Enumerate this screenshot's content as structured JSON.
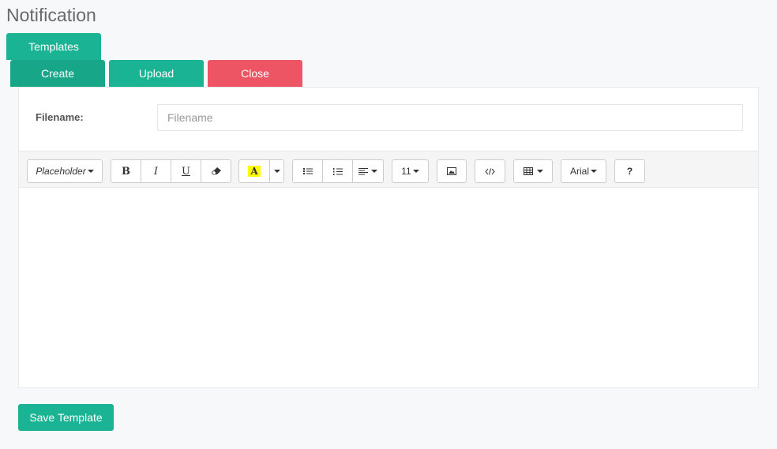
{
  "page": {
    "title": "Notification"
  },
  "nav": {
    "templates_label": "Templates",
    "create_label": "Create",
    "upload_label": "Upload",
    "close_label": "Close"
  },
  "form": {
    "filename_label": "Filename:",
    "filename_placeholder": "Filename",
    "filename_value": ""
  },
  "toolbar": {
    "placeholder_label": "Placeholder",
    "bold": "B",
    "italic": "I",
    "underline": "U",
    "highlight_letter": "A",
    "font_size": "11",
    "font_name": "Arial",
    "help": "?"
  },
  "actions": {
    "save_label": "Save Template"
  },
  "colors": {
    "primary": "#1ab394",
    "danger": "#ed5565",
    "highlight": "#ffff00"
  }
}
